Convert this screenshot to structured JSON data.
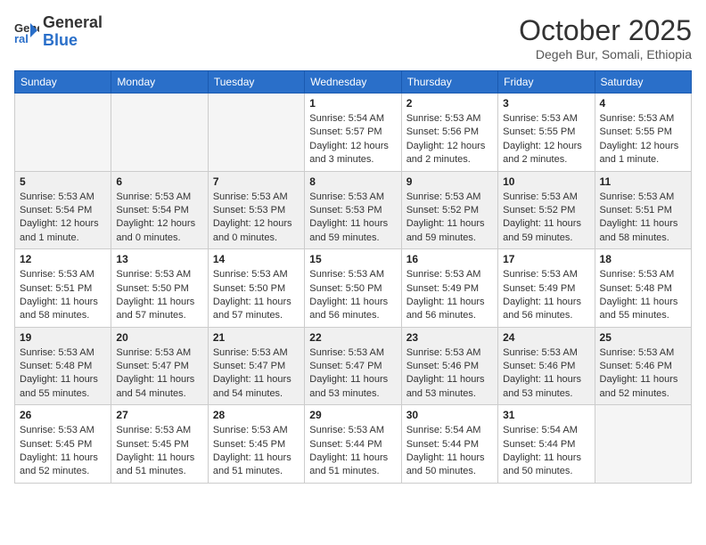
{
  "header": {
    "logo": {
      "line1": "General",
      "line2": "Blue"
    },
    "title": "October 2025",
    "location": "Degeh Bur, Somali, Ethiopia"
  },
  "weekdays": [
    "Sunday",
    "Monday",
    "Tuesday",
    "Wednesday",
    "Thursday",
    "Friday",
    "Saturday"
  ],
  "weeks": [
    [
      {
        "day": "",
        "info": ""
      },
      {
        "day": "",
        "info": ""
      },
      {
        "day": "",
        "info": ""
      },
      {
        "day": "1",
        "info": "Sunrise: 5:54 AM\nSunset: 5:57 PM\nDaylight: 12 hours\nand 3 minutes."
      },
      {
        "day": "2",
        "info": "Sunrise: 5:53 AM\nSunset: 5:56 PM\nDaylight: 12 hours\nand 2 minutes."
      },
      {
        "day": "3",
        "info": "Sunrise: 5:53 AM\nSunset: 5:55 PM\nDaylight: 12 hours\nand 2 minutes."
      },
      {
        "day": "4",
        "info": "Sunrise: 5:53 AM\nSunset: 5:55 PM\nDaylight: 12 hours\nand 1 minute."
      }
    ],
    [
      {
        "day": "5",
        "info": "Sunrise: 5:53 AM\nSunset: 5:54 PM\nDaylight: 12 hours\nand 1 minute."
      },
      {
        "day": "6",
        "info": "Sunrise: 5:53 AM\nSunset: 5:54 PM\nDaylight: 12 hours\nand 0 minutes."
      },
      {
        "day": "7",
        "info": "Sunrise: 5:53 AM\nSunset: 5:53 PM\nDaylight: 12 hours\nand 0 minutes."
      },
      {
        "day": "8",
        "info": "Sunrise: 5:53 AM\nSunset: 5:53 PM\nDaylight: 11 hours\nand 59 minutes."
      },
      {
        "day": "9",
        "info": "Sunrise: 5:53 AM\nSunset: 5:52 PM\nDaylight: 11 hours\nand 59 minutes."
      },
      {
        "day": "10",
        "info": "Sunrise: 5:53 AM\nSunset: 5:52 PM\nDaylight: 11 hours\nand 59 minutes."
      },
      {
        "day": "11",
        "info": "Sunrise: 5:53 AM\nSunset: 5:51 PM\nDaylight: 11 hours\nand 58 minutes."
      }
    ],
    [
      {
        "day": "12",
        "info": "Sunrise: 5:53 AM\nSunset: 5:51 PM\nDaylight: 11 hours\nand 58 minutes."
      },
      {
        "day": "13",
        "info": "Sunrise: 5:53 AM\nSunset: 5:50 PM\nDaylight: 11 hours\nand 57 minutes."
      },
      {
        "day": "14",
        "info": "Sunrise: 5:53 AM\nSunset: 5:50 PM\nDaylight: 11 hours\nand 57 minutes."
      },
      {
        "day": "15",
        "info": "Sunrise: 5:53 AM\nSunset: 5:50 PM\nDaylight: 11 hours\nand 56 minutes."
      },
      {
        "day": "16",
        "info": "Sunrise: 5:53 AM\nSunset: 5:49 PM\nDaylight: 11 hours\nand 56 minutes."
      },
      {
        "day": "17",
        "info": "Sunrise: 5:53 AM\nSunset: 5:49 PM\nDaylight: 11 hours\nand 56 minutes."
      },
      {
        "day": "18",
        "info": "Sunrise: 5:53 AM\nSunset: 5:48 PM\nDaylight: 11 hours\nand 55 minutes."
      }
    ],
    [
      {
        "day": "19",
        "info": "Sunrise: 5:53 AM\nSunset: 5:48 PM\nDaylight: 11 hours\nand 55 minutes."
      },
      {
        "day": "20",
        "info": "Sunrise: 5:53 AM\nSunset: 5:47 PM\nDaylight: 11 hours\nand 54 minutes."
      },
      {
        "day": "21",
        "info": "Sunrise: 5:53 AM\nSunset: 5:47 PM\nDaylight: 11 hours\nand 54 minutes."
      },
      {
        "day": "22",
        "info": "Sunrise: 5:53 AM\nSunset: 5:47 PM\nDaylight: 11 hours\nand 53 minutes."
      },
      {
        "day": "23",
        "info": "Sunrise: 5:53 AM\nSunset: 5:46 PM\nDaylight: 11 hours\nand 53 minutes."
      },
      {
        "day": "24",
        "info": "Sunrise: 5:53 AM\nSunset: 5:46 PM\nDaylight: 11 hours\nand 53 minutes."
      },
      {
        "day": "25",
        "info": "Sunrise: 5:53 AM\nSunset: 5:46 PM\nDaylight: 11 hours\nand 52 minutes."
      }
    ],
    [
      {
        "day": "26",
        "info": "Sunrise: 5:53 AM\nSunset: 5:45 PM\nDaylight: 11 hours\nand 52 minutes."
      },
      {
        "day": "27",
        "info": "Sunrise: 5:53 AM\nSunset: 5:45 PM\nDaylight: 11 hours\nand 51 minutes."
      },
      {
        "day": "28",
        "info": "Sunrise: 5:53 AM\nSunset: 5:45 PM\nDaylight: 11 hours\nand 51 minutes."
      },
      {
        "day": "29",
        "info": "Sunrise: 5:53 AM\nSunset: 5:44 PM\nDaylight: 11 hours\nand 51 minutes."
      },
      {
        "day": "30",
        "info": "Sunrise: 5:54 AM\nSunset: 5:44 PM\nDaylight: 11 hours\nand 50 minutes."
      },
      {
        "day": "31",
        "info": "Sunrise: 5:54 AM\nSunset: 5:44 PM\nDaylight: 11 hours\nand 50 minutes."
      },
      {
        "day": "",
        "info": ""
      }
    ]
  ]
}
